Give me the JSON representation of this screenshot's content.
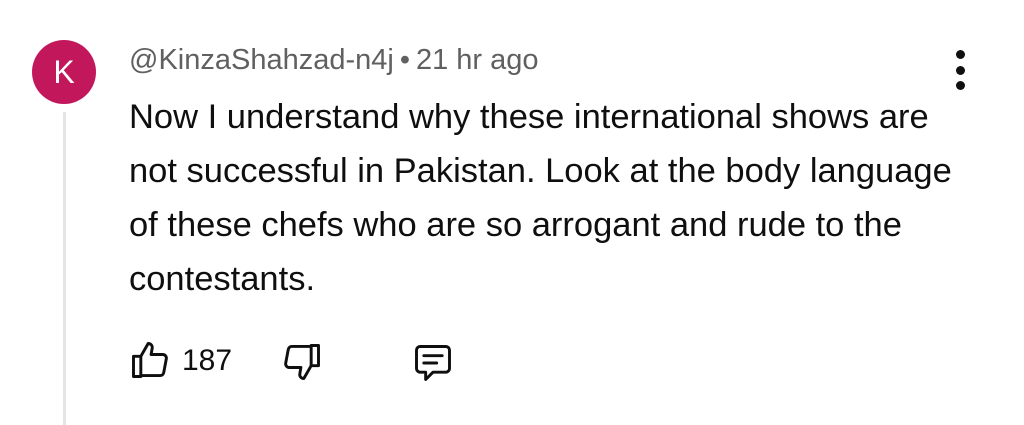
{
  "comment": {
    "avatar_letter": "K",
    "avatar_color": "#c2185b",
    "author": "@KinzaShahzad-n4j",
    "separator": "•",
    "timestamp": "21 hr ago",
    "text": "Now I understand why these international shows are not successful in Pakistan. Look at the body language of these chefs who are so arrogant and rude to the contestants.",
    "like_count": "187",
    "icons": {
      "like": "thumbs-up-icon",
      "dislike": "thumbs-down-icon",
      "reply": "comment-reply-icon",
      "more": "more-vertical-icon"
    }
  }
}
